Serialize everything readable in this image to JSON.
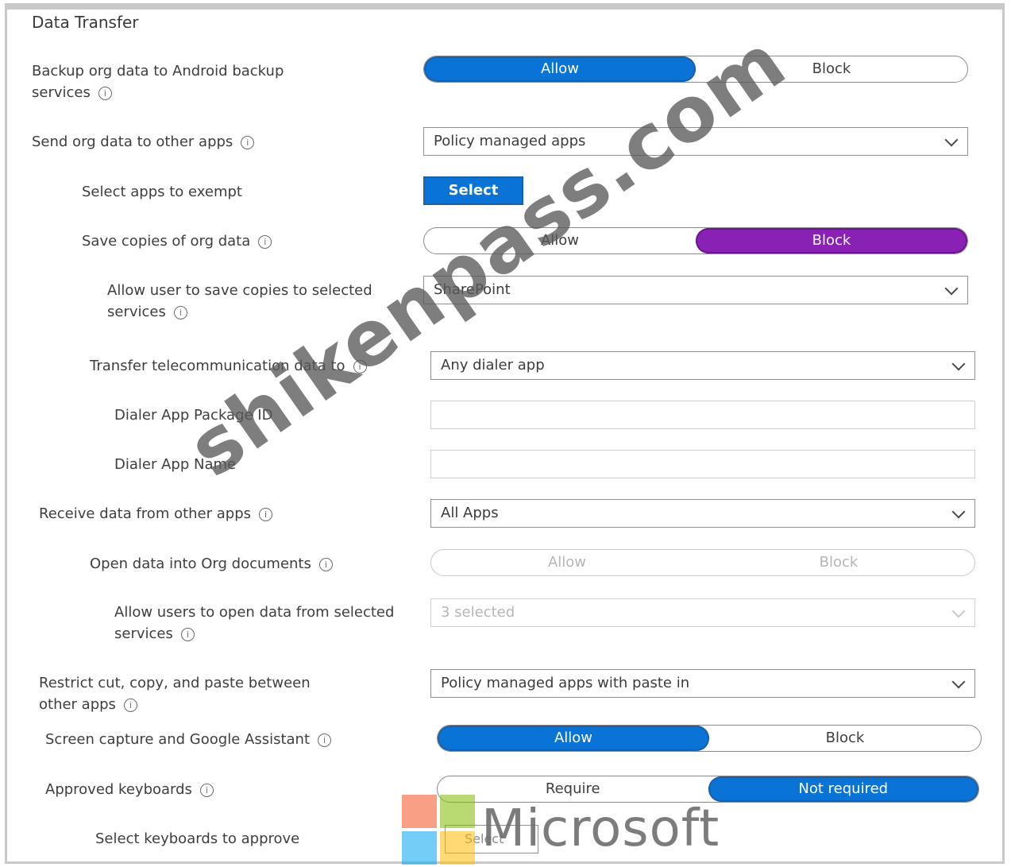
{
  "section": {
    "title": "Data Transfer"
  },
  "rows": {
    "backup": {
      "label": "Backup org data to Android backup services",
      "options": [
        "Allow",
        "Block"
      ],
      "selected": "Allow"
    },
    "send": {
      "label": "Send org data to other apps",
      "value": "Policy managed apps"
    },
    "exempt": {
      "label": "Select apps to exempt",
      "button": "Select"
    },
    "save_copies": {
      "label": "Save copies of org data",
      "options": [
        "Allow",
        "Block"
      ],
      "selected": "Block"
    },
    "save_services": {
      "label": "Allow user to save copies to selected services",
      "value": "SharePoint"
    },
    "telecom": {
      "label": "Transfer telecommunication data to",
      "value": "Any dialer app"
    },
    "dialer_id": {
      "label": "Dialer App Package ID",
      "value": ""
    },
    "dialer_name": {
      "label": "Dialer App Name",
      "value": ""
    },
    "receive": {
      "label": "Receive data from other apps",
      "value": "All Apps"
    },
    "open_org": {
      "label": "Open data into Org documents",
      "options": [
        "Allow",
        "Block"
      ],
      "selected": ""
    },
    "open_services": {
      "label": "Allow users to open data from selected services",
      "value": "3 selected"
    },
    "restrict_cut": {
      "label": "Restrict cut, copy, and paste between other apps",
      "value": "Policy managed apps with paste in"
    },
    "screen_capture": {
      "label": "Screen capture and Google Assistant",
      "options": [
        "Allow",
        "Block"
      ],
      "selected": "Allow"
    },
    "keyboards": {
      "label": "Approved keyboards",
      "options": [
        "Require",
        "Not required"
      ],
      "selected": "Not required"
    },
    "select_keyboards": {
      "label": "Select keyboards to approve",
      "button": "Select"
    }
  },
  "watermark": {
    "text": "shikenpass.com"
  },
  "logo": {
    "text": "Microsoft",
    "colors": [
      "#f25022",
      "#7fba00",
      "#00a4ef",
      "#ffb900"
    ]
  },
  "colors": {
    "accent": "#0a74d6",
    "block_selected": "#8a20b4"
  }
}
